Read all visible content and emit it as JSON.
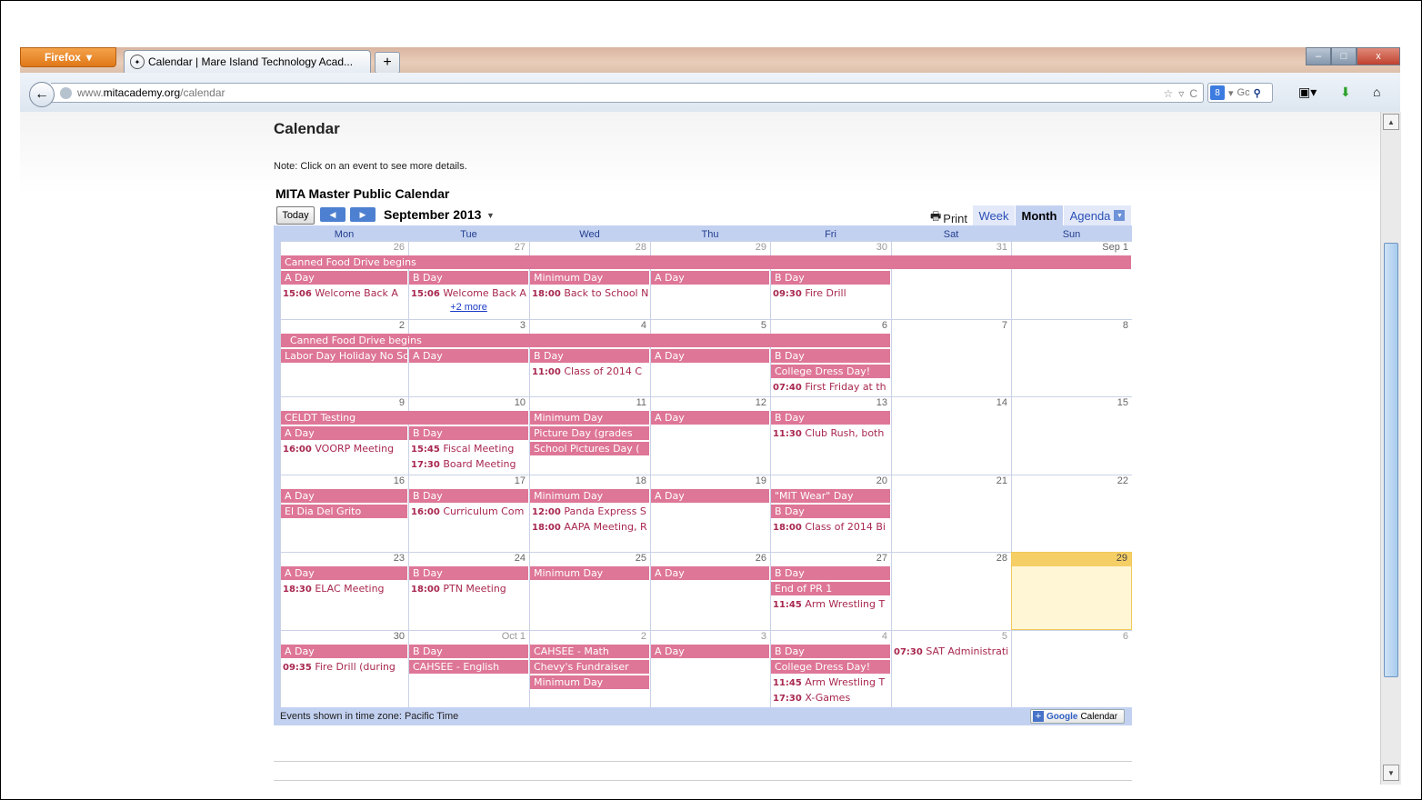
{
  "browser": {
    "app_button": "Firefox",
    "tab_title": "Calendar | Mare Island Technology Acad...",
    "new_tab": "+",
    "url_prefix": "www.",
    "url_domain": "mitacademy.org",
    "url_path": "/calendar",
    "search_engine_label": "Gc",
    "window_buttons": {
      "minimize": "–",
      "maximize": "□",
      "close": "x"
    }
  },
  "page": {
    "title": "Calendar",
    "note": "Note: Click on an event to see more details.",
    "calendar_title": "MITA Master Public Calendar"
  },
  "toolbar": {
    "today": "Today",
    "month_label": "September 2013",
    "print": "Print",
    "views": [
      "Week",
      "Month",
      "Agenda"
    ]
  },
  "colors": {
    "event_bar": "#de7697",
    "event_text": "#a8274f",
    "grid": "#c3d1f1",
    "today": "#fff6d5"
  },
  "weekdays": [
    "Mon",
    "Tue",
    "Wed",
    "Thu",
    "Fri",
    "Sat",
    "Sun"
  ],
  "weeks": [
    {
      "dates": [
        "26",
        "27",
        "28",
        "29",
        "30",
        "31",
        "Sep 1"
      ],
      "in_month": [
        false,
        false,
        false,
        false,
        false,
        false,
        true
      ],
      "items": [
        {
          "type": "bar",
          "row": 0,
          "col": 0,
          "span": 7,
          "text": "Canned Food Drive begins"
        },
        {
          "type": "bar",
          "row": 1,
          "col": 0,
          "span": 1,
          "text": "A Day"
        },
        {
          "type": "bar",
          "row": 1,
          "col": 1,
          "span": 1,
          "text": "B Day"
        },
        {
          "type": "bar",
          "row": 1,
          "col": 2,
          "span": 1,
          "text": "Minimum Day"
        },
        {
          "type": "bar",
          "row": 1,
          "col": 3,
          "span": 1,
          "text": "A Day"
        },
        {
          "type": "bar",
          "row": 1,
          "col": 4,
          "span": 1,
          "text": "B Day"
        },
        {
          "type": "evt",
          "row": 2,
          "col": 0,
          "time": "15:06",
          "text": "Welcome Back A"
        },
        {
          "type": "evt",
          "row": 2,
          "col": 1,
          "time": "15:06",
          "text": "Welcome Back A"
        },
        {
          "type": "evt",
          "row": 2,
          "col": 2,
          "time": "18:00",
          "text": "Back to School N"
        },
        {
          "type": "evt",
          "row": 2,
          "col": 4,
          "time": "09:30",
          "text": "Fire Drill"
        },
        {
          "type": "more",
          "row": 3,
          "col": 1,
          "text": "+2 more"
        }
      ]
    },
    {
      "dates": [
        "2",
        "3",
        "4",
        "5",
        "6",
        "7",
        "8"
      ],
      "in_month": [
        true,
        true,
        true,
        true,
        true,
        true,
        true
      ],
      "items": [
        {
          "type": "bar",
          "row": 0,
          "col": 0,
          "span": 5,
          "text": "Canned Food Drive begins",
          "indent": true
        },
        {
          "type": "bar",
          "row": 1,
          "col": 0,
          "span": 1,
          "text": "Labor Day Holiday No School"
        },
        {
          "type": "bar",
          "row": 1,
          "col": 1,
          "span": 1,
          "text": "A Day"
        },
        {
          "type": "bar",
          "row": 1,
          "col": 2,
          "span": 1,
          "text": "B Day"
        },
        {
          "type": "bar",
          "row": 1,
          "col": 3,
          "span": 1,
          "text": "A Day"
        },
        {
          "type": "bar",
          "row": 1,
          "col": 4,
          "span": 1,
          "text": "B Day"
        },
        {
          "type": "evt",
          "row": 2,
          "col": 2,
          "time": "11:00",
          "text": "Class of 2014 C"
        },
        {
          "type": "bar",
          "row": 2,
          "col": 4,
          "span": 1,
          "text": "College Dress Day!"
        },
        {
          "type": "evt",
          "row": 3,
          "col": 4,
          "time": "07:40",
          "text": "First Friday at th"
        }
      ]
    },
    {
      "dates": [
        "9",
        "10",
        "11",
        "12",
        "13",
        "14",
        "15"
      ],
      "in_month": [
        true,
        true,
        true,
        true,
        true,
        true,
        true
      ],
      "items": [
        {
          "type": "bar",
          "row": 0,
          "col": 0,
          "span": 2,
          "text": "CELDT Testing"
        },
        {
          "type": "bar",
          "row": 0,
          "col": 2,
          "span": 1,
          "text": "Minimum Day"
        },
        {
          "type": "bar",
          "row": 0,
          "col": 3,
          "span": 1,
          "text": "A Day"
        },
        {
          "type": "bar",
          "row": 0,
          "col": 4,
          "span": 1,
          "text": "B Day"
        },
        {
          "type": "bar",
          "row": 1,
          "col": 0,
          "span": 1,
          "text": "A Day"
        },
        {
          "type": "bar",
          "row": 1,
          "col": 1,
          "span": 1,
          "text": "B Day"
        },
        {
          "type": "bar",
          "row": 1,
          "col": 2,
          "span": 1,
          "text": "Picture Day (grades"
        },
        {
          "type": "evt",
          "row": 1,
          "col": 4,
          "time": "11:30",
          "text": "Club Rush, both"
        },
        {
          "type": "evt",
          "row": 2,
          "col": 0,
          "time": "16:00",
          "text": "VOORP Meeting"
        },
        {
          "type": "evt",
          "row": 2,
          "col": 1,
          "time": "15:45",
          "text": "Fiscal Meeting"
        },
        {
          "type": "bar",
          "row": 2,
          "col": 2,
          "span": 1,
          "text": "School Pictures Day ("
        },
        {
          "type": "evt",
          "row": 3,
          "col": 1,
          "time": "17:30",
          "text": "Board Meeting"
        }
      ]
    },
    {
      "dates": [
        "16",
        "17",
        "18",
        "19",
        "20",
        "21",
        "22"
      ],
      "in_month": [
        true,
        true,
        true,
        true,
        true,
        true,
        true
      ],
      "items": [
        {
          "type": "bar",
          "row": 0,
          "col": 0,
          "span": 1,
          "text": "A Day"
        },
        {
          "type": "bar",
          "row": 0,
          "col": 1,
          "span": 1,
          "text": "B Day"
        },
        {
          "type": "bar",
          "row": 0,
          "col": 2,
          "span": 1,
          "text": "Minimum Day"
        },
        {
          "type": "bar",
          "row": 0,
          "col": 3,
          "span": 1,
          "text": "A Day"
        },
        {
          "type": "bar",
          "row": 0,
          "col": 4,
          "span": 1,
          "text": "\"MIT Wear\" Day"
        },
        {
          "type": "bar",
          "row": 1,
          "col": 0,
          "span": 1,
          "text": "El Dia Del Grito"
        },
        {
          "type": "evt",
          "row": 1,
          "col": 1,
          "time": "16:00",
          "text": "Curriculum Com"
        },
        {
          "type": "evt",
          "row": 1,
          "col": 2,
          "time": "12:00",
          "text": "Panda Express S"
        },
        {
          "type": "bar",
          "row": 1,
          "col": 4,
          "span": 1,
          "text": "B Day"
        },
        {
          "type": "evt",
          "row": 2,
          "col": 2,
          "time": "18:00",
          "text": "AAPA Meeting, R"
        },
        {
          "type": "evt",
          "row": 2,
          "col": 4,
          "time": "18:00",
          "text": "Class of 2014 Bi"
        }
      ]
    },
    {
      "dates": [
        "23",
        "24",
        "25",
        "26",
        "27",
        "28",
        "29"
      ],
      "in_month": [
        true,
        true,
        true,
        true,
        true,
        true,
        true
      ],
      "today_col": 6,
      "items": [
        {
          "type": "bar",
          "row": 0,
          "col": 0,
          "span": 1,
          "text": "A Day"
        },
        {
          "type": "bar",
          "row": 0,
          "col": 1,
          "span": 1,
          "text": "B Day"
        },
        {
          "type": "bar",
          "row": 0,
          "col": 2,
          "span": 1,
          "text": "Minimum Day"
        },
        {
          "type": "bar",
          "row": 0,
          "col": 3,
          "span": 1,
          "text": "A Day"
        },
        {
          "type": "bar",
          "row": 0,
          "col": 4,
          "span": 1,
          "text": "B Day"
        },
        {
          "type": "evt",
          "row": 1,
          "col": 0,
          "time": "18:30",
          "text": "ELAC Meeting"
        },
        {
          "type": "evt",
          "row": 1,
          "col": 1,
          "time": "18:00",
          "text": "PTN Meeting"
        },
        {
          "type": "bar",
          "row": 1,
          "col": 4,
          "span": 1,
          "text": "End of PR 1"
        },
        {
          "type": "evt",
          "row": 2,
          "col": 4,
          "time": "11:45",
          "text": "Arm Wrestling T"
        }
      ]
    },
    {
      "dates": [
        "30",
        "Oct 1",
        "2",
        "3",
        "4",
        "5",
        "6"
      ],
      "in_month": [
        true,
        false,
        false,
        false,
        false,
        false,
        false
      ],
      "items": [
        {
          "type": "bar",
          "row": 0,
          "col": 0,
          "span": 1,
          "text": "A Day"
        },
        {
          "type": "bar",
          "row": 0,
          "col": 1,
          "span": 1,
          "text": "B Day"
        },
        {
          "type": "bar",
          "row": 0,
          "col": 2,
          "span": 1,
          "text": "CAHSEE - Math"
        },
        {
          "type": "bar",
          "row": 0,
          "col": 3,
          "span": 1,
          "text": "A Day"
        },
        {
          "type": "bar",
          "row": 0,
          "col": 4,
          "span": 1,
          "text": "B Day"
        },
        {
          "type": "evt",
          "row": 0,
          "col": 5,
          "time": "07:30",
          "text": "SAT Administrati"
        },
        {
          "type": "evt",
          "row": 1,
          "col": 0,
          "time": "09:35",
          "text": "Fire Drill (during"
        },
        {
          "type": "bar",
          "row": 1,
          "col": 1,
          "span": 1,
          "text": "CAHSEE - English"
        },
        {
          "type": "bar",
          "row": 1,
          "col": 2,
          "span": 1,
          "text": "Chevy's Fundraiser"
        },
        {
          "type": "bar",
          "row": 1,
          "col": 4,
          "span": 1,
          "text": "College Dress Day!"
        },
        {
          "type": "bar",
          "row": 2,
          "col": 2,
          "span": 1,
          "text": "Minimum Day"
        },
        {
          "type": "evt",
          "row": 2,
          "col": 4,
          "time": "11:45",
          "text": "Arm Wrestling T"
        },
        {
          "type": "evt",
          "row": 3,
          "col": 4,
          "time": "17:30",
          "text": "X-Games"
        }
      ]
    }
  ],
  "footer": {
    "timezone": "Events shown in time zone: Pacific Time",
    "gcal_brand": "Google",
    "gcal_label": "Calendar"
  }
}
